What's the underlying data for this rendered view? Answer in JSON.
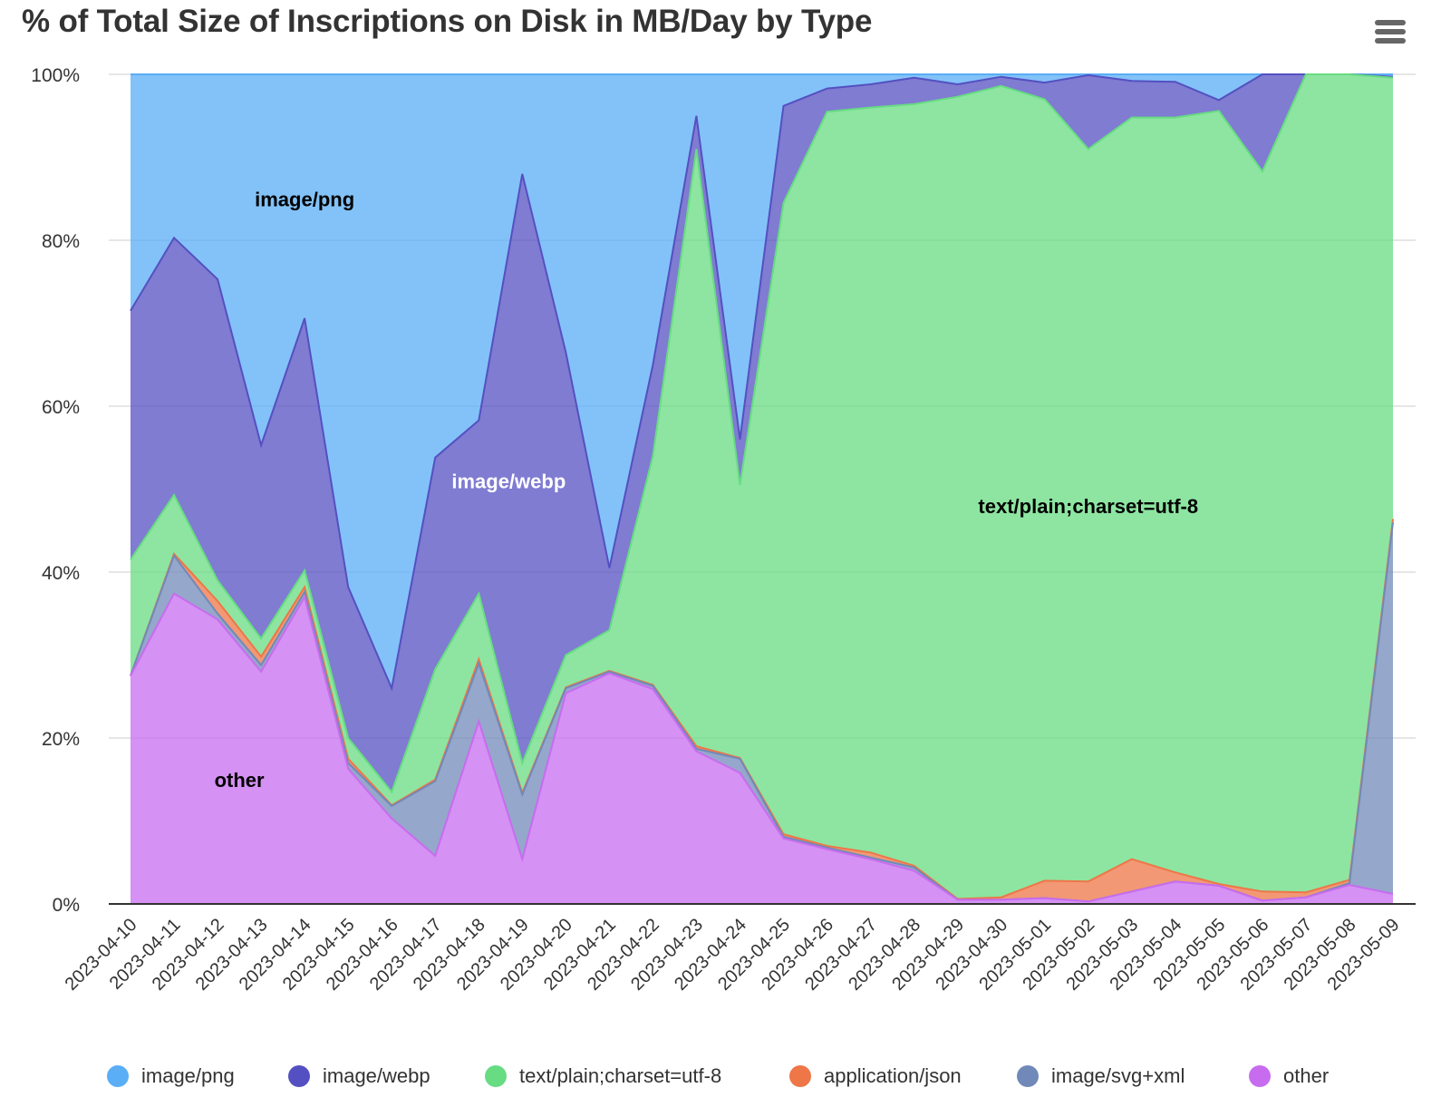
{
  "chart_data": {
    "type": "area",
    "stacking": "percent",
    "title": "% of Total Size of Inscriptions on Disk in MB/Day by Type",
    "xlabel": "",
    "ylabel": "",
    "ylim": [
      0,
      100
    ],
    "yticks": [
      "0%",
      "20%",
      "40%",
      "60%",
      "80%",
      "100%"
    ],
    "grid": true,
    "legend_position": "bottom",
    "categories": [
      "2023-04-10",
      "2023-04-11",
      "2023-04-12",
      "2023-04-13",
      "2023-04-14",
      "2023-04-15",
      "2023-04-16",
      "2023-04-17",
      "2023-04-18",
      "2023-04-19",
      "2023-04-20",
      "2023-04-21",
      "2023-04-22",
      "2023-04-23",
      "2023-04-24",
      "2023-04-25",
      "2023-04-26",
      "2023-04-27",
      "2023-04-28",
      "2023-04-29",
      "2023-04-30",
      "2023-05-01",
      "2023-05-02",
      "2023-05-03",
      "2023-05-04",
      "2023-05-05",
      "2023-05-06",
      "2023-05-07",
      "2023-05-08",
      "2023-05-09"
    ],
    "series": [
      {
        "name": "image/png",
        "color": "#5aaef6",
        "values": [
          28.5,
          19.7,
          24.7,
          44.7,
          29.4,
          61.8,
          74.0,
          46.2,
          41.7,
          12.0,
          33.5,
          59.5,
          35.0,
          5.0,
          44.0,
          3.8,
          1.7,
          1.2,
          0.4,
          1.2,
          0.3,
          1.0,
          0.1,
          0.8,
          0.9,
          3.1,
          0.0,
          0.0,
          0.0,
          0.3
        ]
      },
      {
        "name": "image/webp",
        "color": "#5450c1",
        "values": [
          30.0,
          31.0,
          36.3,
          23.3,
          30.4,
          18.2,
          12.5,
          25.5,
          20.9,
          71.0,
          36.5,
          7.5,
          11.0,
          4.0,
          5.5,
          11.7,
          2.8,
          2.8,
          3.2,
          1.5,
          1.1,
          2.0,
          8.9,
          4.4,
          4.3,
          1.3,
          11.7,
          0.0,
          0.0,
          0.1
        ]
      },
      {
        "name": "text/plain;charset=utf-8",
        "color": "#67dc82",
        "values": [
          14.0,
          7.1,
          2.5,
          2.2,
          2.0,
          2.5,
          1.6,
          13.3,
          7.9,
          3.6,
          3.9,
          4.9,
          27.6,
          72.0,
          32.9,
          76.1,
          88.5,
          89.8,
          91.8,
          96.7,
          97.8,
          94.2,
          88.3,
          89.4,
          91.0,
          93.2,
          86.8,
          98.6,
          97.1,
          53.2
        ]
      },
      {
        "name": "application/json",
        "color": "#ee7647",
        "values": [
          0.0,
          0.2,
          1.5,
          1.0,
          0.6,
          0.5,
          0.1,
          0.2,
          0.5,
          0.2,
          0.1,
          0.1,
          0.1,
          0.3,
          0.1,
          0.3,
          0.2,
          0.6,
          0.2,
          0.1,
          0.3,
          2.1,
          2.4,
          3.9,
          1.1,
          0.2,
          1.1,
          0.6,
          0.4,
          0.4
        ]
      },
      {
        "name": "image/svg+xml",
        "color": "#7189b8",
        "values": [
          0.0,
          4.6,
          0.7,
          0.8,
          0.6,
          0.7,
          1.5,
          9.0,
          7.0,
          7.8,
          0.6,
          0.2,
          0.4,
          0.3,
          1.7,
          0.2,
          0.2,
          0.2,
          0.4,
          0.0,
          0.0,
          0.0,
          0.0,
          0.0,
          0.0,
          0.0,
          0.0,
          0.0,
          0.2,
          44.8
        ]
      },
      {
        "name": "other",
        "color": "#c76cef",
        "values": [
          27.5,
          37.4,
          34.3,
          28.0,
          37.0,
          16.3,
          10.3,
          5.8,
          22.0,
          5.4,
          25.4,
          27.8,
          25.9,
          18.4,
          15.8,
          7.9,
          6.6,
          5.4,
          4.0,
          0.5,
          0.5,
          0.7,
          0.3,
          1.5,
          2.7,
          2.2,
          0.4,
          0.8,
          2.3,
          1.2
        ]
      }
    ],
    "annotations": [
      {
        "text": "image/png",
        "series": "image/png",
        "color": "#000000"
      },
      {
        "text": "image/webp",
        "series": "image/webp",
        "color": "#ffffff"
      },
      {
        "text": "text/plain;charset=utf-8",
        "series": "text/plain;charset=utf-8",
        "color": "#000000"
      },
      {
        "text": "other",
        "series": "other",
        "color": "#000000"
      }
    ]
  },
  "toolbar": {
    "menu_icon": "hamburger-menu-icon"
  }
}
